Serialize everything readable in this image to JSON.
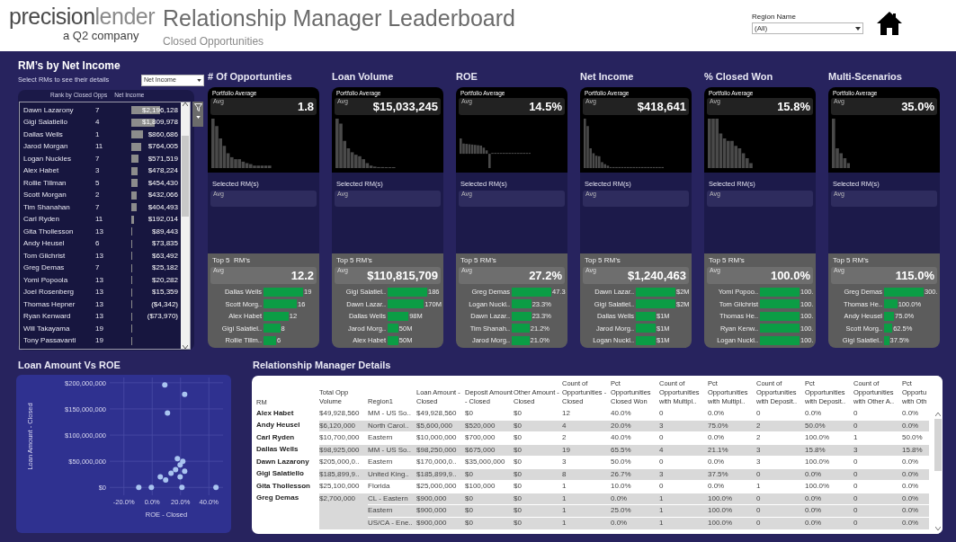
{
  "header": {
    "brand": [
      "precision",
      "lender"
    ],
    "brand_sub": "a Q2 company",
    "title": "Relationship Manager Leaderboard",
    "subtitle": "Closed Opportunities",
    "region_filter": {
      "label": "Region Name",
      "value": "(All)"
    }
  },
  "rm_list": {
    "title": "RM’s by Net Income",
    "hint": "Select RMs to see their details",
    "measure_select": "Net Income",
    "columns": [
      "Rank by Closed Opps",
      "Net Income"
    ],
    "rows": [
      {
        "name": "Dawn Lazarony",
        "rank": "7",
        "value": "$2,196,128"
      },
      {
        "name": "Gigi Salatiello",
        "rank": "4",
        "value": "$1,809,978"
      },
      {
        "name": "Dallas Wells",
        "rank": "1",
        "value": "$860,686"
      },
      {
        "name": "Jarod Morgan",
        "rank": "11",
        "value": "$764,005"
      },
      {
        "name": "Logan Nuckles",
        "rank": "7",
        "value": "$571,519"
      },
      {
        "name": "Alex Habet",
        "rank": "3",
        "value": "$478,224"
      },
      {
        "name": "Rollie Tillman",
        "rank": "5",
        "value": "$454,430"
      },
      {
        "name": "Scott Morgan",
        "rank": "2",
        "value": "$432,066"
      },
      {
        "name": "Tim Shanahan",
        "rank": "7",
        "value": "$404,493"
      },
      {
        "name": "Carl Ryden",
        "rank": "11",
        "value": "$192,014"
      },
      {
        "name": "Gita Thollesson",
        "rank": "13",
        "value": "$89,443"
      },
      {
        "name": "Andy Heusel",
        "rank": "6",
        "value": "$73,835"
      },
      {
        "name": "Tom Gilchrist",
        "rank": "13",
        "value": "$63,492"
      },
      {
        "name": "Greg Demas",
        "rank": "7",
        "value": "$25,182"
      },
      {
        "name": "Yomi Popoola",
        "rank": "13",
        "value": "$20,282"
      },
      {
        "name": "Joel Rosenberg",
        "rank": "13",
        "value": "$15,359"
      },
      {
        "name": "Thomas Hepner",
        "rank": "13",
        "value": "($4,342)"
      },
      {
        "name": "Ryan  Kenward",
        "rank": "13",
        "value": "($73,970)"
      },
      {
        "name": "Will Takayama",
        "rank": "19"
      },
      {
        "name": "Tony Passavanti",
        "rank": "19"
      }
    ]
  },
  "cards": [
    {
      "title": "# Of Opportunties",
      "portfolio_label": "Portfolio Average",
      "portfolio_avg_label": "Avg",
      "portfolio_value": "1.8",
      "selected_label": "Selected RM(s)",
      "selected_avg_label": "Avg",
      "top_label": "Top 5  RM’s",
      "top_avg_label": "Avg",
      "top_value": "12.2",
      "top": [
        {
          "name": "Dallas Wells",
          "value": "19"
        },
        {
          "name": "Scott Morg..",
          "value": "16"
        },
        {
          "name": "Alex Habet",
          "value": "12"
        },
        {
          "name": "Gigi Salatiel..",
          "value": "8"
        },
        {
          "name": "Rollie Tillm..",
          "value": "6"
        }
      ]
    },
    {
      "title": "Loan Volume",
      "portfolio_label": "Portfolio Average",
      "portfolio_avg_label": "Avg",
      "portfolio_value": "$15,033,245",
      "selected_label": "Selected RM(s)",
      "selected_avg_label": "Avg",
      "top_label": "Top 5 RM’s",
      "top_avg_label": "Avg",
      "top_value": "$110,815,709",
      "top": [
        {
          "name": "Gigi Salatiel..",
          "value": "186"
        },
        {
          "name": "Dawn Lazar..",
          "value": "170M"
        },
        {
          "name": "Dallas Wells",
          "value": "98M"
        },
        {
          "name": "Jarod Morg..",
          "value": "50M"
        },
        {
          "name": "Alex Habet",
          "value": "50M"
        }
      ]
    },
    {
      "title": "ROE",
      "portfolio_label": "Portfolio Average",
      "portfolio_avg_label": "Avg",
      "portfolio_value": "14.5%",
      "selected_label": "Selected RM(s)",
      "selected_avg_label": "Avg",
      "top_label": "Top 5 RM’s",
      "top_avg_label": "Avg",
      "top_value": "27.2%",
      "top": [
        {
          "name": "Greg Demas",
          "value": "47.3"
        },
        {
          "name": "Logan Nuckl..",
          "value": "23.3%"
        },
        {
          "name": "Dawn Lazar..",
          "value": "23.3%"
        },
        {
          "name": "Tim Shanah..",
          "value": "21.2%"
        },
        {
          "name": "Jarod Morg..",
          "value": "21.0%"
        }
      ]
    },
    {
      "title": "Net Income",
      "portfolio_label": "Portfolio Average",
      "portfolio_avg_label": "Avg",
      "portfolio_value": "$418,641",
      "selected_label": "Selected RM(s)",
      "selected_avg_label": "Avg",
      "top_label": "Top 5 RM’s",
      "top_avg_label": "Avg",
      "top_value": "$1,240,463",
      "top": [
        {
          "name": "Dawn Lazar..",
          "value": "$2M"
        },
        {
          "name": "Gigi Salatiel..",
          "value": "$2M"
        },
        {
          "name": "Dallas Wells",
          "value": "$1M"
        },
        {
          "name": "Jarod Morg..",
          "value": "$1M"
        },
        {
          "name": "Logan Nuckl..",
          "value": "$1M"
        }
      ]
    },
    {
      "title": "% Closed Won",
      "portfolio_label": "Portfolio Average",
      "portfolio_avg_label": "Avg",
      "portfolio_value": "15.8%",
      "selected_label": "Selected RM(s)",
      "selected_avg_label": "Avg",
      "top_label": "Top 5 RM’s",
      "top_avg_label": "Avg",
      "top_value": "100.0%",
      "top": [
        {
          "name": "Yomi Popoo..",
          "value": "100."
        },
        {
          "name": "Tom Gilchrist",
          "value": "100."
        },
        {
          "name": "Thomas He..",
          "value": "100."
        },
        {
          "name": "Ryan  Kenw..",
          "value": "100."
        },
        {
          "name": "Logan Nuckl..",
          "value": "100."
        }
      ]
    },
    {
      "title": "Multi-Scenarios",
      "portfolio_label": "Portfolio Average",
      "portfolio_avg_label": "Avg",
      "portfolio_value": "35.0%",
      "selected_label": "Selected RM(s)",
      "selected_avg_label": "Avg",
      "top_label": "Top 5 RM’s",
      "top_avg_label": "Avg",
      "top_value": "115.0%",
      "top": [
        {
          "name": "Greg Demas",
          "value": "300."
        },
        {
          "name": "Thomas He..",
          "value": "100.0%"
        },
        {
          "name": "Andy Heusel",
          "value": "75.0%"
        },
        {
          "name": "Scott Morg..",
          "value": "62.5%"
        },
        {
          "name": "Gigi Salatiel..",
          "value": "37.5%"
        }
      ]
    }
  ],
  "scatter": {
    "title": "Loan Amount Vs ROE",
    "chart_data": {
      "type": "scatter",
      "grid": true,
      "xlabel": "ROE - Closed",
      "ylabel": "Loan Amount - Closed",
      "xlim": [
        -30,
        50
      ],
      "ylim": [
        -15000000,
        210000000
      ],
      "xticks": [
        {
          "value": -20,
          "label": "-20.0%"
        },
        {
          "value": 0,
          "label": "0.0%"
        },
        {
          "value": 20,
          "label": "20.0%"
        },
        {
          "value": 40,
          "label": "40.0%"
        }
      ],
      "yticks": [
        {
          "value": 0,
          "label": "$0"
        },
        {
          "value": 50000000,
          "label": "$50,000,000"
        },
        {
          "value": 100000000,
          "label": "$100,000,000"
        },
        {
          "value": 150000000,
          "label": "$150,000,000"
        },
        {
          "value": 200000000,
          "label": "$200,000,000"
        }
      ],
      "x": [
        8.9,
        22.9,
        10.8,
        17.8,
        21.6,
        19.7,
        16.5,
        13.3,
        22.9,
        5.7,
        9.5,
        19.7,
        -9.5,
        -0.6,
        21,
        45
      ],
      "series": [
        {
          "color": "#a9c4f0",
          "values": [
            196000000,
            178000000,
            142000000,
            55000000,
            50000000,
            43000000,
            34000000,
            27000000,
            31000000,
            20000000,
            14000000,
            20000000,
            0,
            0,
            0,
            0
          ]
        }
      ]
    }
  },
  "details": {
    "title": "Relationship Manager Details",
    "columns": [
      "RM",
      "Total Opp Volume",
      "Region1",
      "Loan Amount - Closed",
      "Deposit Amount - Closed",
      "Other Amount - Closed",
      "Count of Opportunities - Closed",
      "Pct Opportunities Closed Won",
      "Count of Opportunities with Multipl..",
      "Pct Opportunities with Multipl..",
      "Count of Opportunities with Deposit..",
      "Pct Opportunities with Deposit..",
      "Count of Opportunities with Other A..",
      "Pct Opportu with Oth"
    ],
    "rows": [
      {
        "rm": "Alex Habet",
        "total": "$49,928,560",
        "lines": [
          [
            "MM - US So..",
            "$49,928,560",
            "$0",
            "$0",
            "12",
            "40.0%",
            "0",
            "0.0%",
            "0",
            "0.0%",
            "0",
            "0.0%"
          ]
        ]
      },
      {
        "rm": "Andy Heusel",
        "total": "$6,120,000",
        "lines": [
          [
            "North Carol..",
            "$5,600,000",
            "$520,000",
            "$0",
            "4",
            "20.0%",
            "3",
            "75.0%",
            "2",
            "50.0%",
            "0",
            "0.0%"
          ]
        ]
      },
      {
        "rm": "Carl Ryden",
        "total": "$10,700,000",
        "lines": [
          [
            "Eastern",
            "$10,000,000",
            "$700,000",
            "$0",
            "2",
            "40.0%",
            "0",
            "0.0%",
            "2",
            "100.0%",
            "1",
            "50.0%"
          ]
        ]
      },
      {
        "rm": "Dallas Wells",
        "total": "$98,925,000",
        "lines": [
          [
            "MM - US So..",
            "$98,250,000",
            "$675,000",
            "$0",
            "19",
            "65.5%",
            "4",
            "21.1%",
            "3",
            "15.8%",
            "3",
            "15.8%"
          ]
        ]
      },
      {
        "rm": "Dawn Lazarony",
        "total": "$205,000,0..",
        "lines": [
          [
            "Eastern",
            "$170,000,0..",
            "$35,000,000",
            "$0",
            "3",
            "50.0%",
            "0",
            "0.0%",
            "3",
            "100.0%",
            "0",
            "0.0%"
          ]
        ]
      },
      {
        "rm": "Gigi Salatiello",
        "total": "$185,899,9..",
        "lines": [
          [
            "United King..",
            "$185,899,9..",
            "$0",
            "$0",
            "8",
            "26.7%",
            "3",
            "37.5%",
            "0",
            "0.0%",
            "0",
            "0.0%"
          ]
        ]
      },
      {
        "rm": "Gita Thollesson",
        "total": "$25,100,000",
        "lines": [
          [
            "Florida",
            "$25,000,000",
            "$100,000",
            "$0",
            "1",
            "10.0%",
            "0",
            "0.0%",
            "1",
            "100.0%",
            "0",
            "0.0%"
          ]
        ]
      },
      {
        "rm": "Greg Demas",
        "total": "$2,700,000",
        "lines": [
          [
            "CL - Eastern",
            "$900,000",
            "$0",
            "$0",
            "1",
            "0.0%",
            "1",
            "100.0%",
            "0",
            "0.0%",
            "0",
            "0.0%"
          ],
          [
            "Eastern",
            "$900,000",
            "$0",
            "$0",
            "1",
            "25.0%",
            "1",
            "100.0%",
            "0",
            "0.0%",
            "0",
            "0.0%"
          ],
          [
            "US/CA - Ene..",
            "$900,000",
            "$0",
            "$0",
            "1",
            "0.0%",
            "1",
            "100.0%",
            "0",
            "0.0%",
            "0",
            "0.0%"
          ]
        ]
      }
    ]
  }
}
